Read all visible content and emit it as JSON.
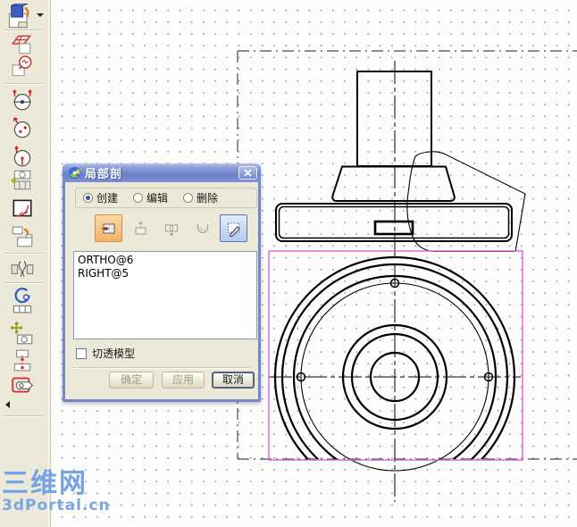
{
  "dialog": {
    "title": "局部剖",
    "modes": [
      {
        "label": "创建",
        "selected": true
      },
      {
        "label": "编辑",
        "selected": false
      },
      {
        "label": "删除",
        "selected": false
      }
    ],
    "tools": [
      {
        "icon": "pick-section-point-icon",
        "state": "active"
      },
      {
        "icon": "direction-arrow-icon",
        "state": "disabled"
      },
      {
        "icon": "depth-point-icon",
        "state": "disabled"
      },
      {
        "icon": "wave-profile-icon",
        "state": "disabled"
      },
      {
        "icon": "sketch-spline-icon",
        "state": "selected"
      }
    ],
    "list": {
      "items": [
        "ORTHO@6",
        "RIGHT@5"
      ]
    },
    "checkbox": {
      "label": "切透模型",
      "checked": false
    },
    "buttons": [
      {
        "label": "确定",
        "enabled": false
      },
      {
        "label": "应用",
        "enabled": false
      },
      {
        "label": "取消",
        "enabled": true
      }
    ]
  },
  "toolbar": {
    "items": [
      {
        "icon": "new-view-icon"
      },
      {
        "icon": "sheet-setup-icon"
      },
      {
        "icon": "detail-zoom-icon"
      },
      {
        "icon": "rotate-view-x-icon"
      },
      {
        "icon": "rotate-view-z-icon"
      },
      {
        "icon": "rotate-view-y-icon"
      },
      {
        "icon": "standard-views-icon"
      },
      {
        "icon": "section-view-icon"
      },
      {
        "icon": "projection-view-icon"
      },
      {
        "icon": "broken-view-icon"
      },
      {
        "icon": "detail-grid-icon"
      },
      {
        "icon": "move-view-icon"
      },
      {
        "icon": "centerline-icon"
      },
      {
        "icon": "view-label-icon"
      }
    ]
  },
  "drawing": {
    "selection_color": "#d95fd9",
    "line_color": "#000000",
    "sheet_border_color": "#4d4d4d",
    "views": [
      "ORTHO@6",
      "RIGHT@5"
    ]
  },
  "watermark": {
    "line1": "三维网",
    "line2": "3dPortal.cn",
    "color": "#6d9fe6"
  }
}
